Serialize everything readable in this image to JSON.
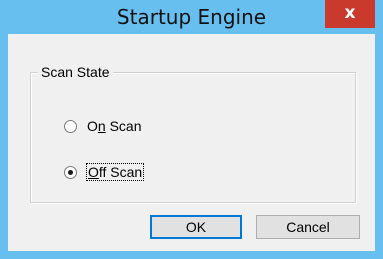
{
  "window": {
    "title": "Startup Engine",
    "close_glyph": "x"
  },
  "group": {
    "legend": "Scan State"
  },
  "options": [
    {
      "label_prefix": "O",
      "label_accel": "n",
      "label_suffix": " Scan",
      "checked": false
    },
    {
      "label_prefix": "",
      "label_accel": "O",
      "label_suffix": "ff Scan",
      "checked": true
    }
  ],
  "buttons": {
    "ok_label": "OK",
    "cancel_label": "Cancel"
  },
  "colors": {
    "titlebar": "#67bff0",
    "close": "#c9392c",
    "client": "#f0f0f0"
  }
}
